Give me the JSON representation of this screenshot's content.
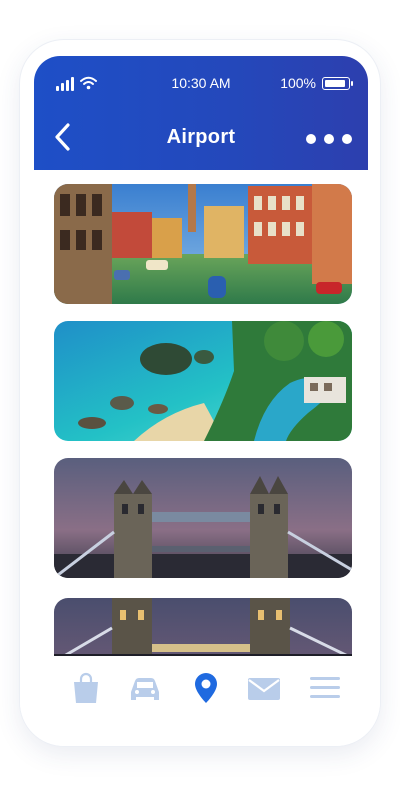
{
  "status_bar": {
    "time": "10:30 AM",
    "battery": "100%",
    "battery_level": 1.0
  },
  "header": {
    "title": "Airport"
  },
  "cards": [
    {
      "label": "venice-grand-canal"
    },
    {
      "label": "tropical-beach-resort"
    },
    {
      "label": "tower-bridge-dusk"
    },
    {
      "label": "tower-bridge-night"
    }
  ],
  "tab_bar": {
    "icons": [
      "shopping-bag-icon",
      "car-icon",
      "location-pin-icon",
      "mail-icon",
      "menu-icon"
    ],
    "active_index": 2,
    "colors": {
      "inactive": "#b9cdea",
      "active": "#1f6ae0"
    }
  },
  "colors": {
    "header_start": "#1e4fc7",
    "header_end": "#2d3fae"
  }
}
